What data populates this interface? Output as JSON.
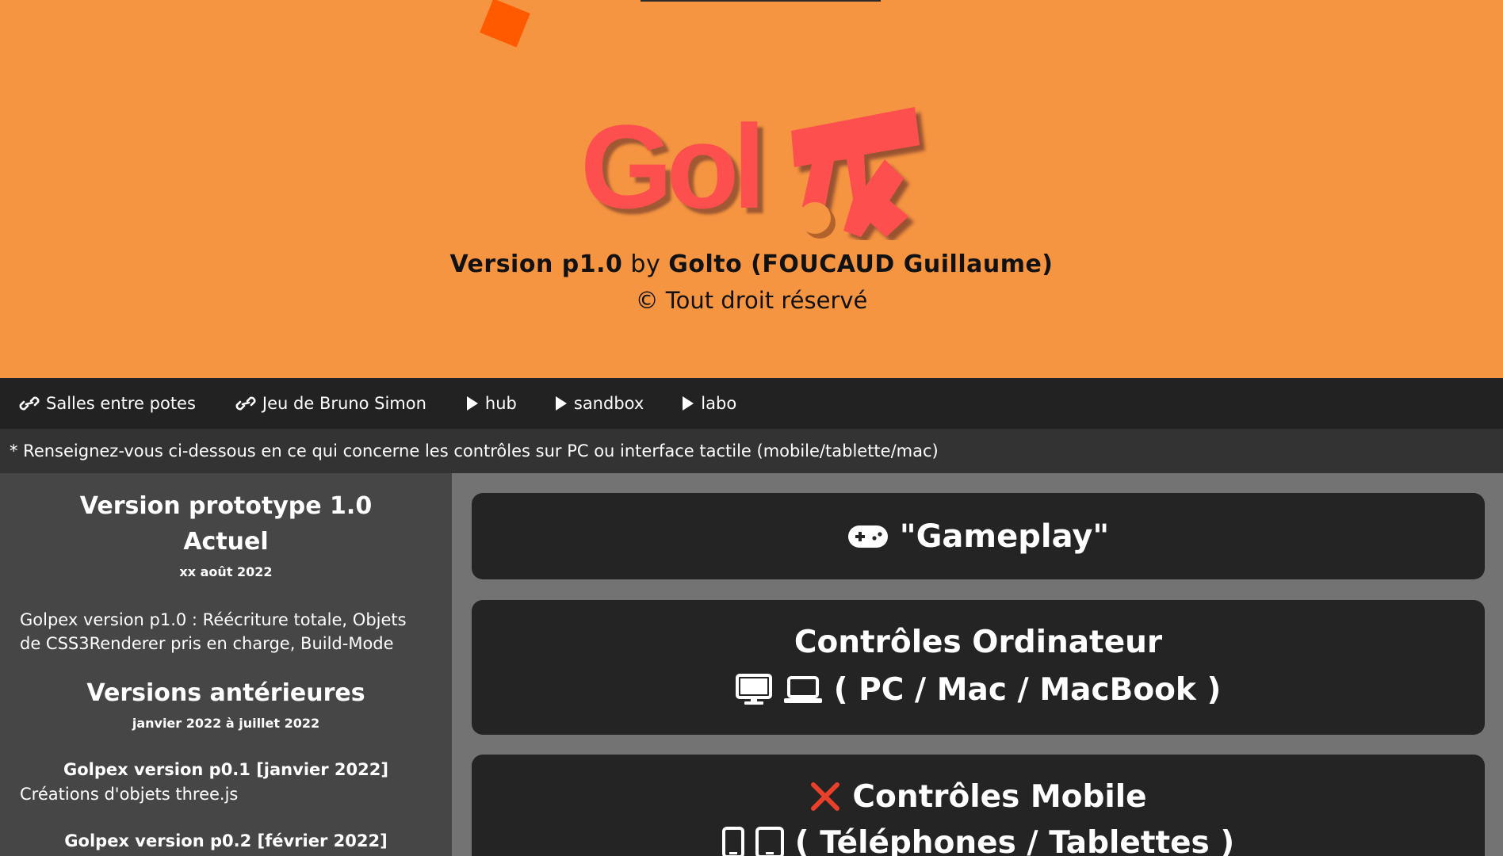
{
  "hero": {
    "logo_text": "Gol",
    "version": "Version p1.0",
    "by": "by",
    "author": "Golto (FOUCAUD Guillaume)",
    "copyright": "© Tout droit réservé",
    "background_color": "#f59541",
    "logo_color": "#fe4f4f"
  },
  "nav": {
    "links": [
      {
        "label": "Salles entre potes",
        "icon": "link-icon"
      },
      {
        "label": "Jeu de Bruno Simon",
        "icon": "link-icon"
      },
      {
        "label": "hub",
        "icon": "play-icon"
      },
      {
        "label": "sandbox",
        "icon": "play-icon"
      },
      {
        "label": "labo",
        "icon": "play-icon"
      }
    ]
  },
  "notice": "* Renseignez-vous ci-dessous en ce qui concerne les contrôles sur PC ou interface tactile (mobile/tablette/mac)",
  "sidebar": {
    "current_title_1": "Version prototype 1.0",
    "current_title_2": "Actuel",
    "current_date": "xx août 2022",
    "current_desc": "Golpex version p1.0 : Réécriture totale, Objets de CSS3Renderer pris en charge, Build-Mode",
    "previous_title": "Versions antérieures",
    "previous_date": "janvier 2022 à juillet 2022",
    "versions": [
      {
        "title": "Golpex version p0.1 [janvier 2022]",
        "desc": "Créations d'objets three.js"
      },
      {
        "title": "Golpex version p0.2 [février 2022]",
        "desc": ""
      }
    ]
  },
  "cards": {
    "gameplay": {
      "label": "\"Gameplay\"",
      "icon": "gamepad-icon"
    },
    "computer": {
      "title": "Contrôles Ordinateur",
      "subtitle": "( PC / Mac / MacBook )",
      "icons": [
        "desktop-icon",
        "laptop-icon"
      ]
    },
    "mobile": {
      "title": "Contrôles Mobile",
      "subtitle": "( Téléphones / Tablettes )",
      "icons": [
        "close-icon",
        "phone-icon",
        "tablet-icon"
      ],
      "status_color": "#e8402a"
    }
  }
}
